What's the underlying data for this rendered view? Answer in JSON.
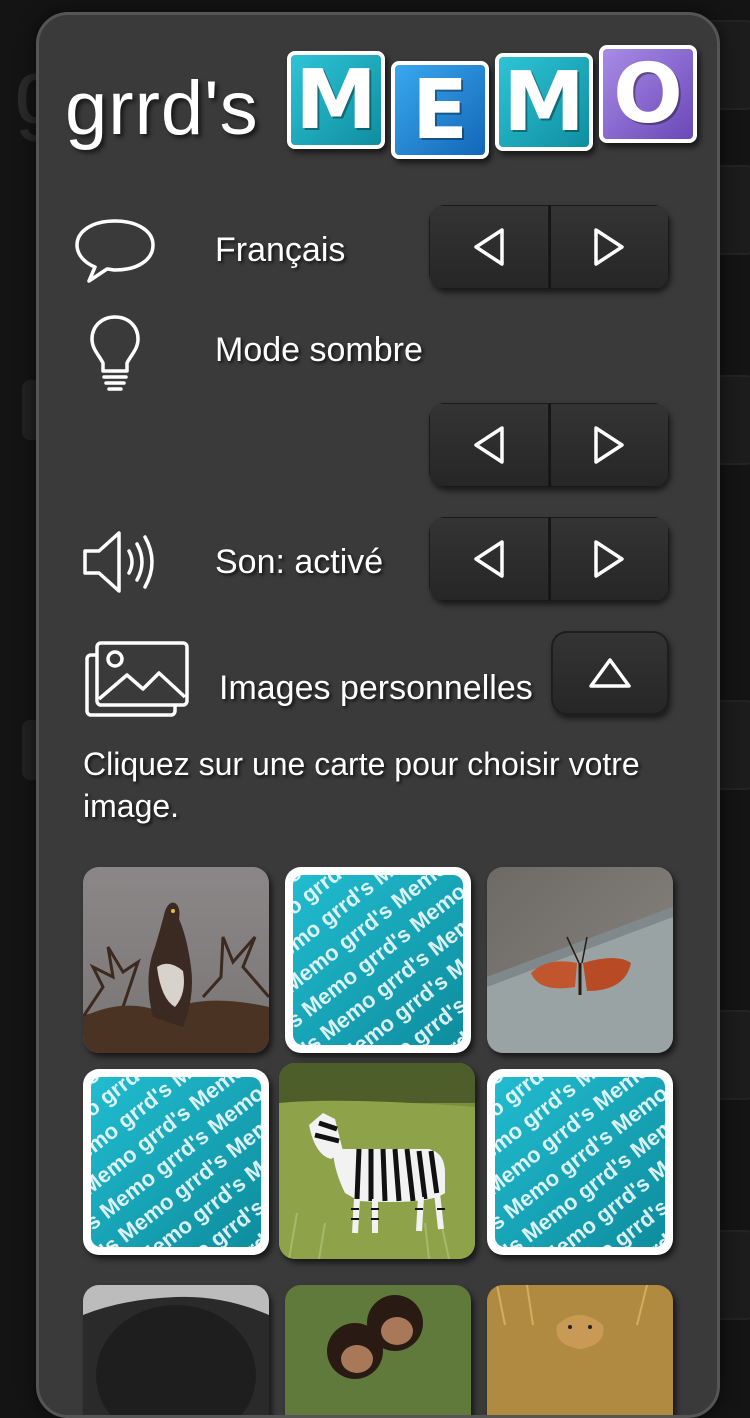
{
  "app": {
    "logo_prefix": "grrd's",
    "logo_letters": [
      "M",
      "E",
      "M",
      "O"
    ],
    "background_title": "g"
  },
  "settings": {
    "language": {
      "label": "Français",
      "icon": "speech-bubble-icon"
    },
    "dark_mode": {
      "label": "Mode sombre",
      "icon": "lightbulb-icon"
    },
    "sound": {
      "label": "Son: activé",
      "icon": "speaker-icon"
    },
    "custom_images": {
      "label": "Images personnelles",
      "icon": "images-icon"
    },
    "prev_icon": "triangle-left-icon",
    "next_icon": "triangle-right-icon",
    "collapse_icon": "triangle-up-icon"
  },
  "hint": "Cliquez sur une carte pour choisir votre image.",
  "card_back_text": "grrd's Memo grrd's Memo grrd's",
  "cards": [
    {
      "type": "photo",
      "subject": "eagle"
    },
    {
      "type": "back"
    },
    {
      "type": "photo",
      "subject": "butterfly"
    },
    {
      "type": "back"
    },
    {
      "type": "photo",
      "subject": "zebra"
    },
    {
      "type": "back"
    },
    {
      "type": "photo",
      "subject": "gorilla"
    },
    {
      "type": "photo",
      "subject": "chimpanzees"
    },
    {
      "type": "photo",
      "subject": "lioness"
    }
  ],
  "colors": {
    "dialog_bg": "#3a3a3a",
    "teal": "#1aa9bc",
    "blue": "#1f7fd0",
    "purple": "#8a6ad6"
  }
}
